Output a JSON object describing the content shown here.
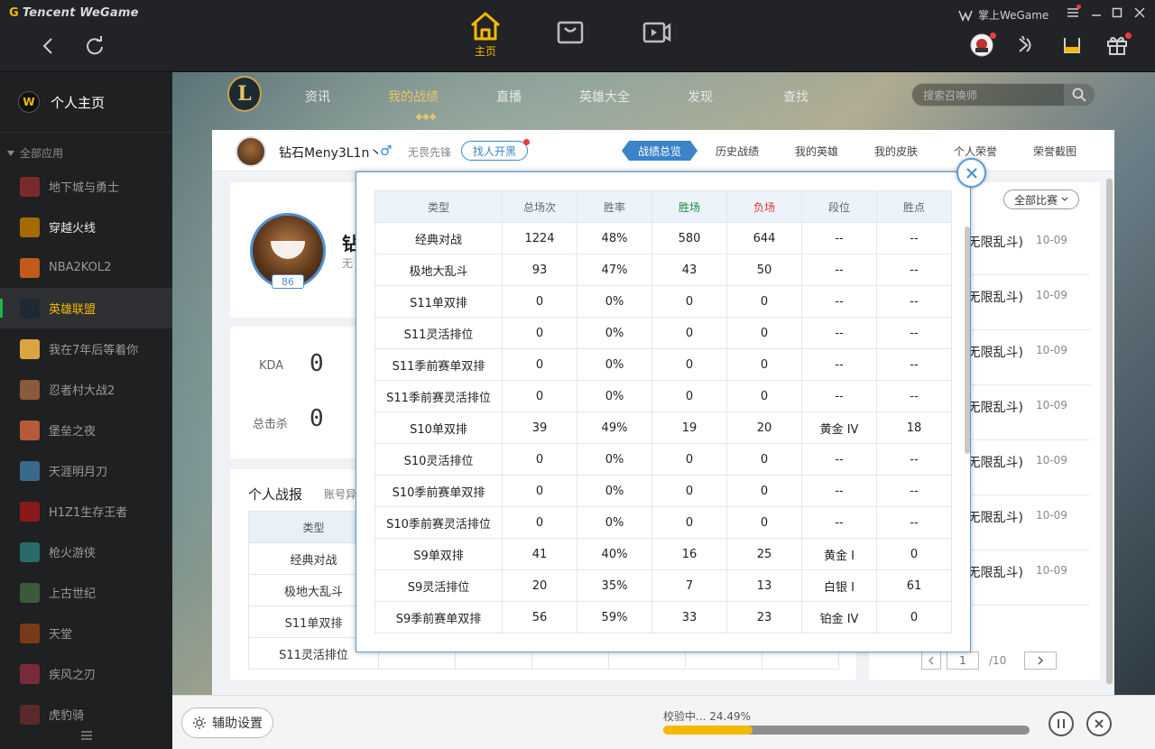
{
  "app": {
    "brand": "Tencent WeGame",
    "main_nav": [
      {
        "label": "主页",
        "icon": "home-icon",
        "active": true
      },
      {
        "label": "",
        "icon": "store-icon"
      },
      {
        "label": "",
        "icon": "video-icon"
      }
    ],
    "mobile_label": "掌上WeGame"
  },
  "sidebar": {
    "home_label": "个人主页",
    "all_apps_label": "全部应用",
    "items": [
      {
        "label": "地下城与勇士",
        "icon": "dnf-icon",
        "color": "#7a2a2a"
      },
      {
        "label": "穿越火线",
        "icon": "cf-icon",
        "color": "#a36b00"
      },
      {
        "label": "NBA2KOL2",
        "icon": "basketball-icon",
        "color": "#c15a1c"
      },
      {
        "label": "英雄联盟",
        "icon": "lol-icon",
        "color": "#1e2a33"
      },
      {
        "label": "我在7年后等着你",
        "icon": "anime-icon",
        "color": "#d9a441"
      },
      {
        "label": "忍者村大战2",
        "icon": "ninja-icon",
        "color": "#8a5a3a"
      },
      {
        "label": "堡垒之夜",
        "icon": "fortnite-icon",
        "color": "#b55b3a"
      },
      {
        "label": "天涯明月刀",
        "icon": "blade-icon",
        "color": "#3a6a8a"
      },
      {
        "label": "H1Z1生存王者",
        "icon": "h1z1-icon",
        "color": "#8a1a1a"
      },
      {
        "label": "枪火游侠",
        "icon": "gunfire-icon",
        "color": "#2a6a6a"
      },
      {
        "label": "上古世纪",
        "icon": "archeage-icon",
        "color": "#3a5a3a"
      },
      {
        "label": "天堂",
        "icon": "lineage-icon",
        "color": "#7a3a1a"
      },
      {
        "label": "疾风之刃",
        "icon": "wind-blade-icon",
        "color": "#7a2a3a"
      },
      {
        "label": "虎豹骑",
        "icon": "tiger-icon",
        "color": "#5a2a2a"
      }
    ]
  },
  "lol": {
    "nav": [
      "资讯",
      "我的战绩",
      "直播",
      "英雄大全",
      "发现",
      "查找"
    ],
    "search_placeholder": "搜索召唤师"
  },
  "profile": {
    "name": "钻石Meny3L1n丶",
    "title": "无畏先锋",
    "find_btn": "找人开黑",
    "tabs": [
      "战绩总览",
      "历史战绩",
      "我的英雄",
      "我的皮肤",
      "个人荣誉",
      "荣誉截图"
    ],
    "level": "86",
    "big_name": "钻",
    "big_sub": "无",
    "kda_label": "KDA",
    "kda_value": "0",
    "kills_label": "总击杀",
    "kills_value": "0",
    "report_title": "个人战报",
    "report_sub": "账号异",
    "under_table": {
      "header": "类型",
      "rows": [
        "经典对战",
        "极地大乱斗",
        "S11单双排",
        "S11灵活排位"
      ]
    }
  },
  "right_panel": {
    "filter": "全部比赛",
    "items": [
      {
        "mode": "(无限乱斗)",
        "date": "10-09"
      },
      {
        "mode": "(无限乱斗)",
        "date": "10-09"
      },
      {
        "mode": "(无限乱斗)",
        "date": "10-09"
      },
      {
        "mode": "(无限乱斗)",
        "date": "10-09"
      },
      {
        "mode": "(无限乱斗)",
        "date": "10-09"
      },
      {
        "mode": "(无限乱斗)",
        "date": "10-09"
      },
      {
        "mode": "(无限乱斗)",
        "date": "10-09"
      }
    ],
    "page_current": "1",
    "page_total": "/10"
  },
  "popup": {
    "columns": [
      "类型",
      "总场次",
      "胜率",
      "胜场",
      "负场",
      "段位",
      "胜点"
    ],
    "rows": [
      [
        "经典对战",
        "1224",
        "48%",
        "580",
        "644",
        "--",
        "--"
      ],
      [
        "极地大乱斗",
        "93",
        "47%",
        "43",
        "50",
        "--",
        "--"
      ],
      [
        "S11单双排",
        "0",
        "0%",
        "0",
        "0",
        "--",
        "--"
      ],
      [
        "S11灵活排位",
        "0",
        "0%",
        "0",
        "0",
        "--",
        "--"
      ],
      [
        "S11季前赛单双排",
        "0",
        "0%",
        "0",
        "0",
        "--",
        "--"
      ],
      [
        "S11季前赛灵活排位",
        "0",
        "0%",
        "0",
        "0",
        "--",
        "--"
      ],
      [
        "S10单双排",
        "39",
        "49%",
        "19",
        "20",
        "黄金 IV",
        "18"
      ],
      [
        "S10灵活排位",
        "0",
        "0%",
        "0",
        "0",
        "--",
        "--"
      ],
      [
        "S10季前赛单双排",
        "0",
        "0%",
        "0",
        "0",
        "--",
        "--"
      ],
      [
        "S10季前赛灵活排位",
        "0",
        "0%",
        "0",
        "0",
        "--",
        "--"
      ],
      [
        "S9单双排",
        "41",
        "40%",
        "16",
        "25",
        "黄金 Ⅰ",
        "0"
      ],
      [
        "S9灵活排位",
        "20",
        "35%",
        "7",
        "13",
        "白银 Ⅰ",
        "61"
      ],
      [
        "S9季前赛单双排",
        "56",
        "59%",
        "33",
        "23",
        "铂金 IV",
        "0"
      ]
    ]
  },
  "bottom": {
    "assist_label": "辅助设置",
    "progress_text": "校验中... 24.49%",
    "progress_value": 24.49
  },
  "colors": {
    "accent": "#f6b900",
    "blue": "#3c83c9",
    "win": "#1e8a44",
    "lose": "#d93535"
  }
}
